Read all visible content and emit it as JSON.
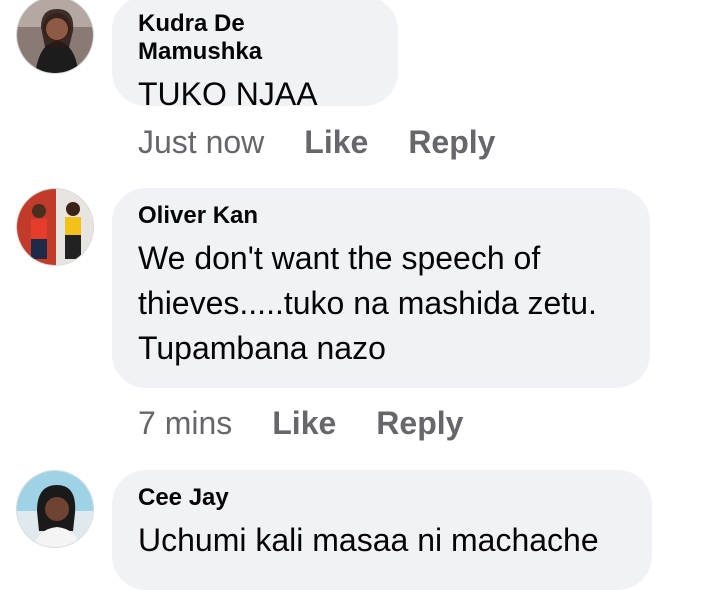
{
  "comments": [
    {
      "author": "Kudra De Mamushka",
      "text": "TUKO NJAA",
      "time": "Just now",
      "like_label": "Like",
      "reply_label": "Reply"
    },
    {
      "author": "Oliver Kan",
      "text": "We don't want the speech of thieves.....tuko na mashida zetu. Tupambana nazo",
      "time": "7 mins",
      "like_label": "Like",
      "reply_label": "Reply"
    },
    {
      "author": "Cee Jay",
      "text": "Uchumi kali masaa ni machache"
    }
  ],
  "colors": {
    "bubble": "#f0f2f5",
    "meta_text": "#65676b",
    "body_text": "#050505"
  }
}
